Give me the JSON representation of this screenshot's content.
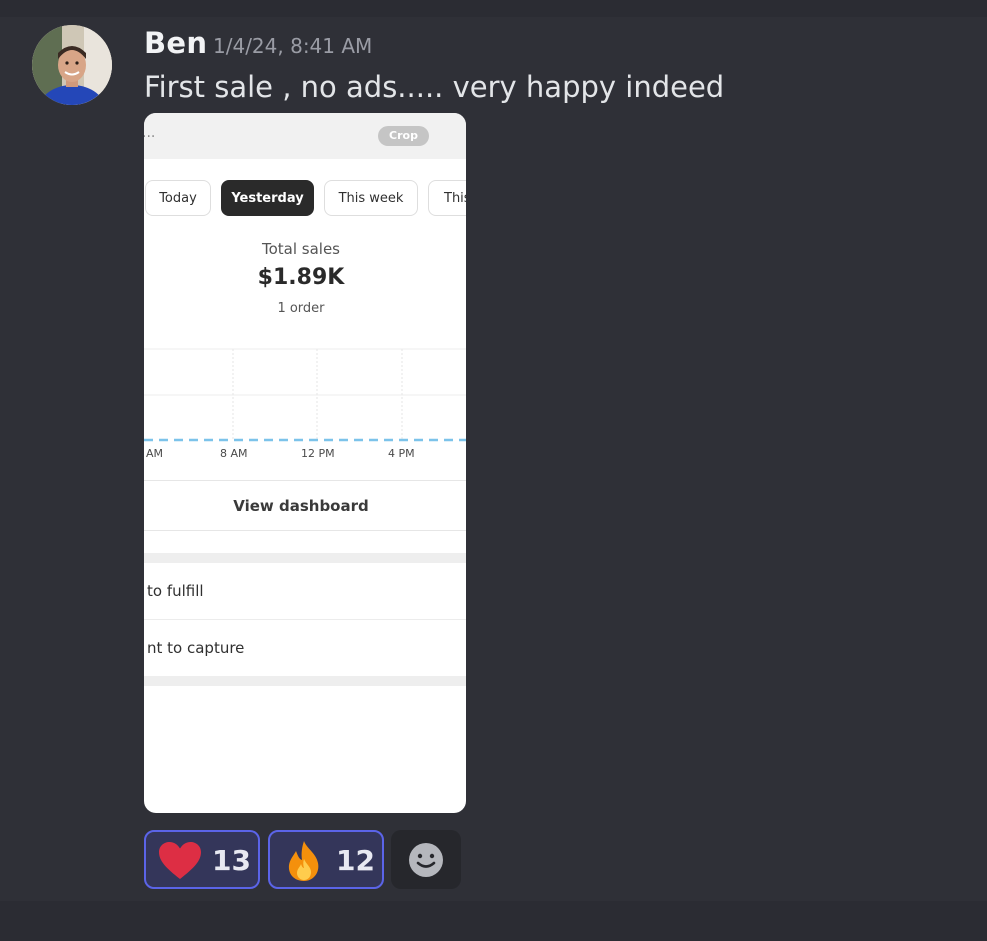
{
  "message": {
    "author": "Ben",
    "timestamp": "1/4/24, 8:41 AM",
    "text": "First sale , no ads..... very happy indeed",
    "avatar_icon": "user-avatar-photo"
  },
  "attachment": {
    "top_dots": "...",
    "crop_label": "Crop",
    "tabs": [
      {
        "label": "Today",
        "active": false
      },
      {
        "label": "Yesterday",
        "active": true
      },
      {
        "label": "This week",
        "active": false
      },
      {
        "label": "This",
        "active": false
      }
    ],
    "sales_label": "Total sales",
    "sales_value": "$1.89K",
    "orders_label": "1 order",
    "chart_x_labels": [
      "AM",
      "8 AM",
      "12 PM",
      "4 PM"
    ],
    "view_dashboard_label": "View dashboard",
    "rows": [
      "to fulfill",
      "nt to capture"
    ]
  },
  "reactions": [
    {
      "icon": "heart-icon",
      "count": "13"
    },
    {
      "icon": "fire-icon",
      "count": "12"
    }
  ],
  "add_reaction_icon": "smiley-add-reaction-icon",
  "colors": {
    "background": "#2f3037",
    "reaction_bg": "#34365a",
    "reaction_border": "#5b64e8",
    "heart": "#dd2e44",
    "chart_line": "#7cc3ea"
  }
}
